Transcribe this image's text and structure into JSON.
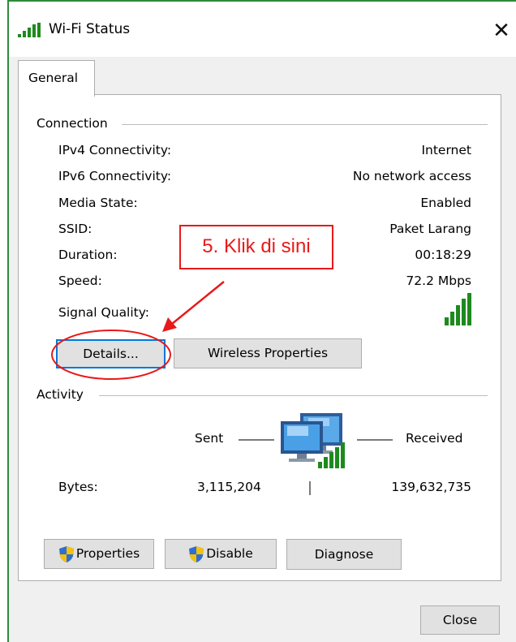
{
  "window": {
    "title": "Wi-Fi Status",
    "close_glyph": "✕"
  },
  "tabs": [
    {
      "label": "General"
    }
  ],
  "connection": {
    "heading": "Connection",
    "rows": [
      {
        "label": "IPv4 Connectivity:",
        "value": "Internet"
      },
      {
        "label": "IPv6 Connectivity:",
        "value": "No network access"
      },
      {
        "label": "Media State:",
        "value": "Enabled"
      },
      {
        "label": "SSID:",
        "value": "Paket Larang"
      },
      {
        "label": "Duration:",
        "value": "00:18:29"
      },
      {
        "label": "Speed:",
        "value": "72.2 Mbps"
      }
    ],
    "signal_label": "Signal Quality:",
    "signal_bars": 5,
    "details_button": "Details...",
    "wireless_button": "Wireless Properties"
  },
  "activity": {
    "heading": "Activity",
    "sent_label": "Sent",
    "received_label": "Received",
    "bytes_label": "Bytes:",
    "bytes_sent": "3,115,204",
    "bytes_received": "139,632,735"
  },
  "buttons": {
    "properties": "Properties",
    "disable": "Disable",
    "diagnose": "Diagnose",
    "close": "Close"
  },
  "annotation": {
    "text": "5. Klik di sini",
    "color": "#e8191a"
  },
  "icons": {
    "title": "wifi-signal-icon",
    "signal": "signal-strength-icon",
    "network": "network-computers-icon",
    "shield": "uac-shield-icon"
  },
  "colors": {
    "focus": "#0078d7",
    "signal_green": "#1e8a1e",
    "frame": "#2e8b3a"
  }
}
